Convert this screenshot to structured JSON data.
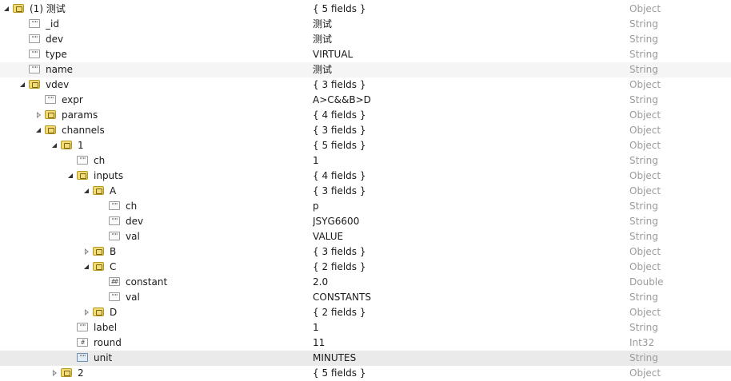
{
  "rows": [
    {
      "key": "(1) 测试",
      "value": "{ 5 fields }",
      "type": "Object",
      "depth": 0,
      "toggle": "expanded",
      "icon": "object"
    },
    {
      "key": "_id",
      "value": "测试",
      "type": "String",
      "depth": 1,
      "toggle": "none",
      "icon": "string"
    },
    {
      "key": "dev",
      "value": "测试",
      "type": "String",
      "depth": 1,
      "toggle": "none",
      "icon": "string"
    },
    {
      "key": "type",
      "value": "VIRTUAL",
      "type": "String",
      "depth": 1,
      "toggle": "none",
      "icon": "string"
    },
    {
      "key": "name",
      "value": "测试",
      "type": "String",
      "depth": 1,
      "toggle": "none",
      "icon": "string",
      "hover": true
    },
    {
      "key": "vdev",
      "value": "{ 3 fields }",
      "type": "Object",
      "depth": 1,
      "toggle": "expanded",
      "icon": "object"
    },
    {
      "key": "expr",
      "value": "A>C&&B>D",
      "type": "String",
      "depth": 2,
      "toggle": "none",
      "icon": "string"
    },
    {
      "key": "params",
      "value": "{ 4 fields }",
      "type": "Object",
      "depth": 2,
      "toggle": "collapsed",
      "icon": "object"
    },
    {
      "key": "channels",
      "value": "{ 3 fields }",
      "type": "Object",
      "depth": 2,
      "toggle": "expanded",
      "icon": "object"
    },
    {
      "key": "1",
      "value": "{ 5 fields }",
      "type": "Object",
      "depth": 3,
      "toggle": "expanded",
      "icon": "object"
    },
    {
      "key": "ch",
      "value": "1",
      "type": "String",
      "depth": 4,
      "toggle": "none",
      "icon": "string"
    },
    {
      "key": "inputs",
      "value": "{ 4 fields }",
      "type": "Object",
      "depth": 4,
      "toggle": "expanded",
      "icon": "object"
    },
    {
      "key": "A",
      "value": "{ 3 fields }",
      "type": "Object",
      "depth": 5,
      "toggle": "expanded",
      "icon": "object"
    },
    {
      "key": "ch",
      "value": "p",
      "type": "String",
      "depth": 6,
      "toggle": "none",
      "icon": "string"
    },
    {
      "key": "dev",
      "value": "JSYG6600",
      "type": "String",
      "depth": 6,
      "toggle": "none",
      "icon": "string"
    },
    {
      "key": "val",
      "value": "VALUE",
      "type": "String",
      "depth": 6,
      "toggle": "none",
      "icon": "string"
    },
    {
      "key": "B",
      "value": "{ 3 fields }",
      "type": "Object",
      "depth": 5,
      "toggle": "collapsed",
      "icon": "object"
    },
    {
      "key": "C",
      "value": "{ 2 fields }",
      "type": "Object",
      "depth": 5,
      "toggle": "expanded",
      "icon": "object"
    },
    {
      "key": "constant",
      "value": "2.0",
      "type": "Double",
      "depth": 6,
      "toggle": "none",
      "icon": "double"
    },
    {
      "key": "val",
      "value": "CONSTANTS",
      "type": "String",
      "depth": 6,
      "toggle": "none",
      "icon": "string"
    },
    {
      "key": "D",
      "value": "{ 2 fields }",
      "type": "Object",
      "depth": 5,
      "toggle": "collapsed",
      "icon": "object"
    },
    {
      "key": "label",
      "value": "1",
      "type": "String",
      "depth": 4,
      "toggle": "none",
      "icon": "string"
    },
    {
      "key": "round",
      "value": "11",
      "type": "Int32",
      "depth": 4,
      "toggle": "none",
      "icon": "int32"
    },
    {
      "key": "unit",
      "value": "MINUTES",
      "type": "String",
      "depth": 4,
      "toggle": "none",
      "icon": "string",
      "selected": true
    },
    {
      "key": "2",
      "value": "{ 5 fields }",
      "type": "Object",
      "depth": 3,
      "toggle": "collapsed",
      "icon": "object"
    }
  ],
  "icon_glyphs": {
    "string": "\"\"",
    "double": "##",
    "int32": "#"
  },
  "colors": {
    "type_text": "#9a9a9a",
    "object_icon": "#f0dc78",
    "selected_row": "#eaeaea"
  }
}
